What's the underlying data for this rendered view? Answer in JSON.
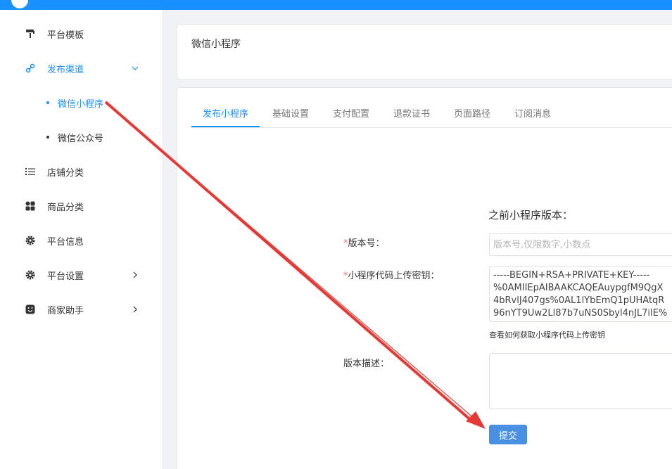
{
  "sidebar": {
    "items": [
      {
        "label": "平台模板",
        "icon": "paint-roller-icon"
      },
      {
        "label": "发布渠道",
        "icon": "link-icon"
      },
      {
        "label": "店铺分类",
        "icon": "list-icon"
      },
      {
        "label": "商品分类",
        "icon": "grid-icon"
      },
      {
        "label": "平台信息",
        "icon": "gear-icon"
      },
      {
        "label": "平台设置",
        "icon": "gear-icon"
      },
      {
        "label": "商家助手",
        "icon": "smile-icon"
      }
    ],
    "sub_items": [
      {
        "label": "微信小程序"
      },
      {
        "label": "微信公众号"
      }
    ]
  },
  "header": {
    "title": "微信小程序"
  },
  "tabs": [
    {
      "label": "发布小程序"
    },
    {
      "label": "基础设置"
    },
    {
      "label": "支付配置"
    },
    {
      "label": "退款证书"
    },
    {
      "label": "页面路径"
    },
    {
      "label": "订阅消息"
    }
  ],
  "form": {
    "section_title": "之前小程序版本：",
    "version_label": "版本号：",
    "version_placeholder": "版本号,仅限数字,小数点",
    "required_mark": "*",
    "key_label": "小程序代码上传密钥：",
    "key_lines": [
      "-----BEGIN+RSA+PRIVATE+KEY-----",
      "%0AMIIEpAIBAAKCAQEAuypgfM9QgX",
      "4bRvlJ407gs%0AL1lYbEmQ1pUHAtqR",
      "96nYT9Uw2Ll87b7uNS0Sbyl4nJL7ilE%"
    ],
    "key_help": "查看如何获取小程序代码上传密钥",
    "desc_label": "版本描述：",
    "submit_label": "提交"
  },
  "colors": {
    "accent": "#1890ff",
    "button": "#4a90e2",
    "required": "#f56c6c",
    "annotation_arrow": "#e53935"
  }
}
